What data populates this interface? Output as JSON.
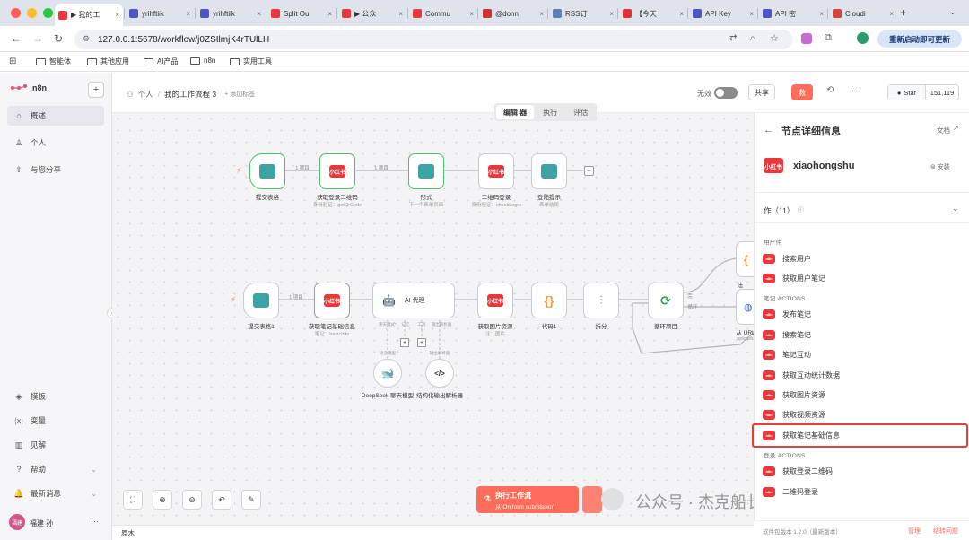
{
  "browser": {
    "tabs": [
      {
        "label": "▶ 我的工",
        "fav": "n8n-icon",
        "color": "#e8383b"
      },
      {
        "label": "yrihftiik",
        "fav": "doc-icon",
        "color": "#4b56c8"
      },
      {
        "label": "yrihftiik",
        "fav": "doc-icon",
        "color": "#4b56c8"
      },
      {
        "label": "Split Ou",
        "fav": "n8n-icon",
        "color": "#e8383b"
      },
      {
        "label": "▶ 公众",
        "fav": "n8n-icon",
        "color": "#e8383b"
      },
      {
        "label": "Commu",
        "fav": "n8n-icon",
        "color": "#e8383b"
      },
      {
        "label": "@donn",
        "fav": "square-icon",
        "color": "#c33"
      },
      {
        "label": "RSS订",
        "fav": "rss-icon",
        "color": "#5b7fb8"
      },
      {
        "label": "【今天",
        "fav": "square-icon",
        "color": "#d33"
      },
      {
        "label": "API Key",
        "fav": "doc-icon",
        "color": "#4b56c8"
      },
      {
        "label": "API 密",
        "fav": "doc-icon",
        "color": "#4b56c8"
      },
      {
        "label": "Cloudi",
        "fav": "gmail-icon",
        "color": "#d44638"
      }
    ],
    "new_tab": "+",
    "url": "127.0.0.1:5678/workflow/j0ZSIlmjK4rTUlLH",
    "relaunch": "重新启动即可更新",
    "bookmarks": [
      "智能体",
      "其他应用",
      "AI产品",
      "n8n",
      "实用工具"
    ]
  },
  "app": {
    "logo": "n8n",
    "nav_top": [
      {
        "label": "概述",
        "icon": "home-icon"
      },
      {
        "label": "个人",
        "icon": "user-icon"
      },
      {
        "label": "与您分享",
        "icon": "share-icon"
      }
    ],
    "nav_bottom": [
      {
        "label": "模板",
        "icon": "template-icon"
      },
      {
        "label": "变量",
        "icon": "variable-icon"
      },
      {
        "label": "见解",
        "icon": "chart-icon"
      },
      {
        "label": "帮助",
        "icon": "help-icon"
      },
      {
        "label": "最新消息",
        "icon": "bell-icon"
      }
    ],
    "user": {
      "avatar": "福建",
      "name": "福建 孙"
    }
  },
  "header": {
    "breadcrumb_owner": "个人",
    "workflow_name": "我的工作流程 3",
    "add_tag": "+ 添加标签",
    "inactive_label": "无效",
    "share": "共享",
    "save": "救",
    "more": "···",
    "star": "Star",
    "star_count": "151,119"
  },
  "canvas": {
    "tabs": [
      "编辑 器",
      "执行",
      "评估"
    ],
    "row1": [
      {
        "label": "提交表格",
        "sub": ""
      },
      {
        "label": "获取登录二维码",
        "sub": "身份验证：getQrCode"
      },
      {
        "label": "形式",
        "sub": "下一个表单页面"
      },
      {
        "label": "二维码登录",
        "sub": "身份验证：checkLogin"
      },
      {
        "label": "登陆提示",
        "sub": "表单结尾"
      }
    ],
    "row1_edges": [
      "1 项目",
      "1 项目"
    ],
    "row2": [
      {
        "label": "提交表格1",
        "sub": ""
      },
      {
        "label": "获取笔记基础信息",
        "sub": "笔记：basicInfo"
      },
      {
        "label": "AI 代理",
        "sub": ""
      },
      {
        "label": "获取图片资源",
        "sub": "注：图片"
      },
      {
        "label": "代码1",
        "sub": ""
      },
      {
        "label": "拆分",
        "sub": ""
      },
      {
        "label": "循环项目",
        "sub": ""
      },
      {
        "label": "从 URL",
        "sub": "uploadu"
      }
    ],
    "row2_edge": "1 项目",
    "agent_ports": [
      "聊天模式*",
      "记忆",
      "工具",
      "输出解析器"
    ],
    "loop_ports": [
      "完",
      "循环"
    ],
    "right_partial": "法",
    "tools": [
      {
        "label": "DeepSeek 聊天模型",
        "sub": "语言模型"
      },
      {
        "label": "结构化输出解析器",
        "sub": "输出解析器"
      }
    ],
    "exec_button": "执行工作流",
    "exec_sub": "从 On form submission",
    "watermark": "公众号 · 杰克船长的AIGC",
    "footer_label": "原木"
  },
  "panel": {
    "title": "节点详细信息",
    "docs": "文档",
    "node_name": "xiaohongshu",
    "install": "安装",
    "actions_label": "作（11）",
    "sections": [
      {
        "title": "用户件",
        "items": [
          "搜索用户",
          "获取用户笔记"
        ]
      },
      {
        "title": "笔记 ACTIONS",
        "items": [
          "发布笔记",
          "搜索笔记",
          "笔记互动",
          "获取互动统计数据",
          "获取图片资源",
          "获取视频资源",
          "获取笔记基础信息"
        ]
      },
      {
        "title": "登录 ACTIONS",
        "items": [
          "获取登录二维码",
          "二维码登录"
        ]
      }
    ],
    "highlight_item": "获取笔记基础信息",
    "highlight_color": "#e0413a",
    "version": "软件包版本 1.2.0（最新版本）",
    "manage": "管理",
    "report": "结转问题"
  },
  "colors": {
    "accent": "#ff6d5a",
    "xhs": "#e8383b"
  }
}
